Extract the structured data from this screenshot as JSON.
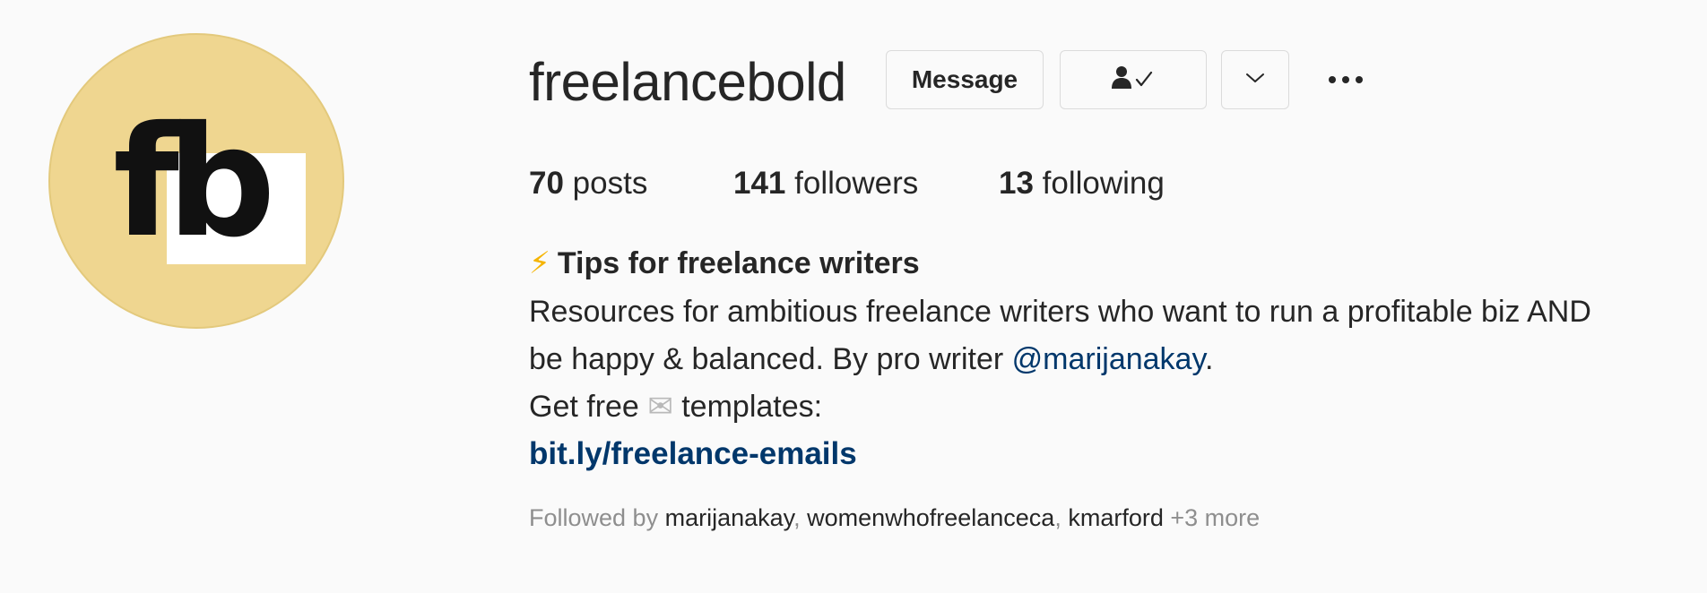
{
  "profile": {
    "username": "freelancebold",
    "avatar": {
      "logo_text": "fb",
      "background_color": "#efd690"
    }
  },
  "actions": {
    "message_label": "Message",
    "following_icon": "person-check-icon",
    "suggestions_icon": "chevron-down-icon",
    "more_icon": "ellipsis-icon"
  },
  "stats": {
    "posts": {
      "count": "70",
      "label": "posts"
    },
    "followers": {
      "count": "141",
      "label": "followers"
    },
    "following": {
      "count": "13",
      "label": "following"
    }
  },
  "bio": {
    "title_emoji": "⚡",
    "title": "Tips for freelance writers",
    "line1": "Resources for ambitious freelance writers who want to run a profitable biz AND",
    "line2_pre": "be happy & balanced. By pro writer ",
    "mention": "@marijanakay",
    "line2_post": ".",
    "line3_pre": "Get free ",
    "line3_emoji": "✉",
    "line3_post": " templates:",
    "link": "bit.ly/freelance-emails"
  },
  "followed_by": {
    "prefix": "Followed by ",
    "names": [
      "marijanakay",
      "womenwhofreelanceca",
      "kmarford"
    ],
    "sep": ", ",
    "more": " +3 more"
  },
  "colors": {
    "link": "#00376b",
    "bolt": "#f5b400",
    "muted": "#8e8e8e",
    "border": "#dbdbdb"
  }
}
